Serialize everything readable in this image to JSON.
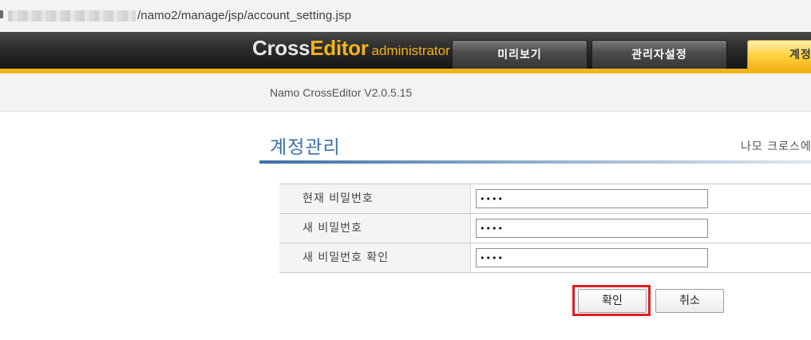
{
  "browser": {
    "url_visible": "/namo2/manage/jsp/account_setting.jsp"
  },
  "header": {
    "brand_cross": "Cross",
    "brand_editor": "Editor",
    "brand_admin": "administrator",
    "tabs": [
      {
        "label": "미리보기",
        "active": false
      },
      {
        "label": "관리자설정",
        "active": false
      },
      {
        "label": "계정",
        "active": true
      }
    ],
    "accent_color": "#f0b418"
  },
  "version_text": "Namo CrossEditor V2.0.5.15",
  "page": {
    "title": "계정관리",
    "subtitle": "나모 크로스에"
  },
  "form": {
    "fields": [
      {
        "label": "현재 비밀번호",
        "value": "1234"
      },
      {
        "label": "새 비밀번호",
        "value": "1234"
      },
      {
        "label": "새 비밀번호 확인",
        "value": "1234"
      }
    ]
  },
  "buttons": {
    "confirm": "확인",
    "cancel": "취소"
  },
  "highlight_color": "#e11d24"
}
